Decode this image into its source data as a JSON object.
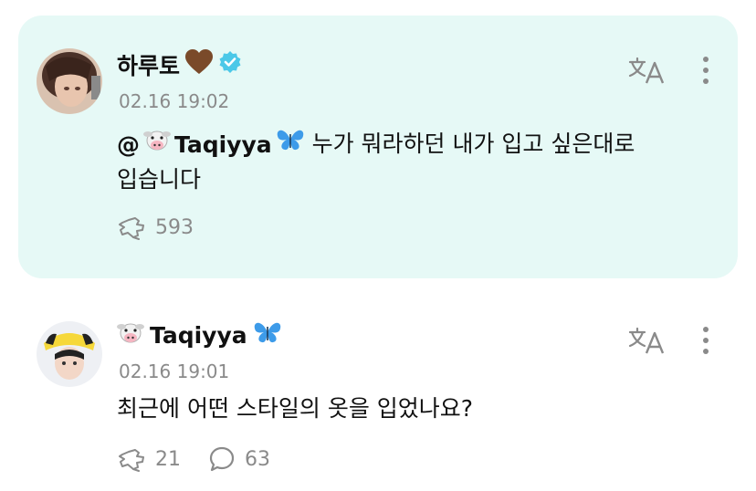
{
  "posts": [
    {
      "author": "하루토",
      "timestamp": "02.16 19:02",
      "mention": "@",
      "mention_name": "Taqiyya",
      "text_line1": "누가 뭐라하던 내가 입고 싶은대로",
      "text_line2": "입습니다",
      "metrics": {
        "reactions": "593"
      },
      "icons": [
        "verified-badge-icon",
        "brown-heart-emoji",
        "cow-emoji",
        "butterfly-emoji",
        "translate-icon",
        "more-vertical-icon",
        "reaction-icon"
      ],
      "colors": {
        "card_bg": "#e6f9f6",
        "verified": "#4cc8e8"
      }
    },
    {
      "author": "Taqiyya",
      "timestamp": "02.16 19:01",
      "text_line1": "최근에 어떤 스타일의 옷을 입었나요?",
      "metrics": {
        "reactions": "21",
        "comments": "63"
      },
      "icons": [
        "cow-emoji",
        "butterfly-emoji",
        "translate-icon",
        "more-vertical-icon",
        "reaction-icon",
        "comment-icon"
      ]
    }
  ]
}
